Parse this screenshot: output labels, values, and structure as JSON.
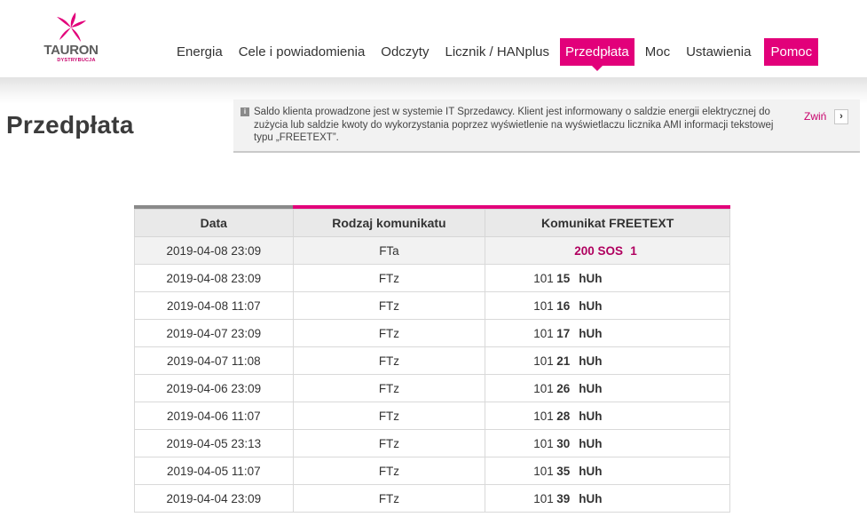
{
  "brand": {
    "name": "TAURON",
    "subname": "DYSTRYBUCJA",
    "accent": "#e2007a"
  },
  "nav": {
    "items": [
      {
        "label": "Energia",
        "active": false
      },
      {
        "label": "Cele i powiadomienia",
        "active": false
      },
      {
        "label": "Odczyty",
        "active": false
      },
      {
        "label": "Licznik / HANplus",
        "active": false
      },
      {
        "label": "Przedpłata",
        "active": true
      },
      {
        "label": "Moc",
        "active": false
      },
      {
        "label": "Ustawienia",
        "active": false
      }
    ],
    "help_label": "Pomoc"
  },
  "page": {
    "title": "Przedpłata"
  },
  "info": {
    "icon": "info-icon",
    "icon_glyph": "i",
    "text": "Saldo klienta prowadzone jest w systemie IT Sprzedawcy. Klient jest informowany o saldzie energii elektrycznej do zużycia lub saldzie kwoty do wykorzystania poprzez wyświetlenie na wyświetlaczu licznika AMI informacji tekstowej typu „FREETEXT”.",
    "collapse_label": "Zwiń",
    "collapse_glyph": "›"
  },
  "table": {
    "headers": [
      "Data",
      "Rodzaj komunikatu",
      "Komunikat FREETEXT"
    ],
    "rows": [
      {
        "date": "2019-04-08 23:09",
        "type": "FTa",
        "code": "200 SOS",
        "value": "1",
        "unit": ""
      },
      {
        "date": "2019-04-08 23:09",
        "type": "FTz",
        "code": "101",
        "value": "15",
        "unit": "hUh"
      },
      {
        "date": "2019-04-08 11:07",
        "type": "FTz",
        "code": "101",
        "value": "16",
        "unit": "hUh"
      },
      {
        "date": "2019-04-07 23:09",
        "type": "FTz",
        "code": "101",
        "value": "17",
        "unit": "hUh"
      },
      {
        "date": "2019-04-07 11:08",
        "type": "FTz",
        "code": "101",
        "value": "21",
        "unit": "hUh"
      },
      {
        "date": "2019-04-06 23:09",
        "type": "FTz",
        "code": "101",
        "value": "26",
        "unit": "hUh"
      },
      {
        "date": "2019-04-06 11:07",
        "type": "FTz",
        "code": "101",
        "value": "28",
        "unit": "hUh"
      },
      {
        "date": "2019-04-05 23:13",
        "type": "FTz",
        "code": "101",
        "value": "30",
        "unit": "hUh"
      },
      {
        "date": "2019-04-05 11:07",
        "type": "FTz",
        "code": "101",
        "value": "35",
        "unit": "hUh"
      },
      {
        "date": "2019-04-04 23:09",
        "type": "FTz",
        "code": "101",
        "value": "39",
        "unit": "hUh"
      }
    ]
  }
}
